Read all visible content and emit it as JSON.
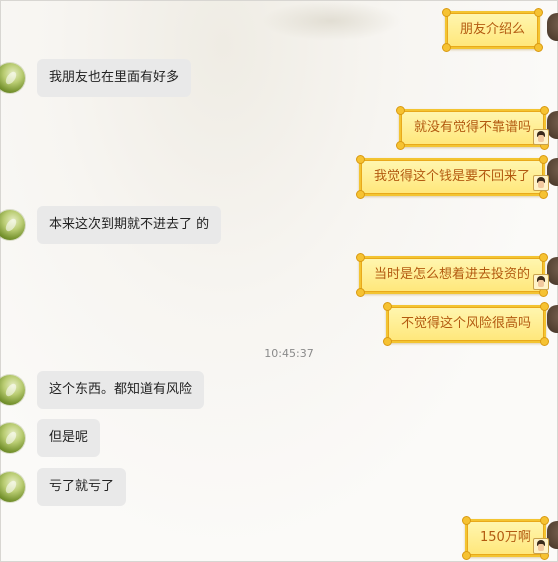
{
  "chat": {
    "messages": [
      {
        "side": "out",
        "text": "朋友介绍么"
      },
      {
        "side": "in",
        "text": "我朋友也在里面有好多"
      },
      {
        "side": "out",
        "text": "就没有觉得不靠谱吗"
      },
      {
        "side": "out",
        "text": "我觉得这个钱是要不回来了"
      },
      {
        "side": "in",
        "text": "本来这次到期就不进去了 的"
      },
      {
        "side": "out",
        "text": "当时是怎么想着进去投资的"
      },
      {
        "side": "out",
        "text": "不觉得这个风险很高吗"
      },
      {
        "side": "in",
        "text": "这个东西。都知道有风险"
      },
      {
        "side": "in",
        "text": "但是呢"
      },
      {
        "side": "in",
        "text": "亏了就亏了"
      },
      {
        "side": "out",
        "text": "150万啊"
      }
    ],
    "timestamp": "10:45:37"
  },
  "colors": {
    "out_bubble": "#ffe77a",
    "out_border": "#f3c431",
    "out_text": "#b35a10",
    "in_bubble": "#e9e9e9",
    "in_text": "#222222"
  }
}
